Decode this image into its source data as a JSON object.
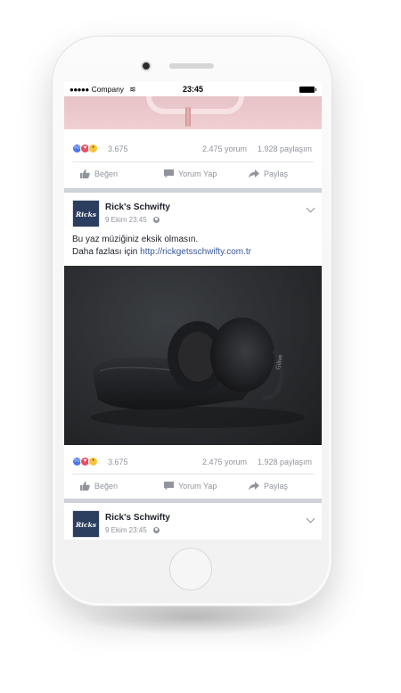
{
  "status_bar": {
    "signal": "●●●●●",
    "carrier": "Company",
    "wifi": "≋",
    "time": "23:45"
  },
  "post_top": {
    "reaction_count": "3.675",
    "comments": "2.475 yorum",
    "shares": "1.928 paylaşım",
    "actions": {
      "like": "Beğen",
      "comment": "Yorum Yap",
      "share": "Paylaş"
    }
  },
  "post_main": {
    "page_name": "Rick's Schwifty",
    "avatar_text": "Ricks",
    "date": "9 Ekim 23:45",
    "text_line1": "Bu yaz müziğiniz eksik olmasın.",
    "text_line2_prefix": "Daha fazlası için",
    "link": "http://rickgetsschwifty.com.tr",
    "reaction_count": "3.675",
    "comments": "2.475 yorum",
    "shares": "1.928 paylaşım",
    "actions": {
      "like": "Beğen",
      "comment": "Yorum Yap",
      "share": "Paylaş"
    },
    "headphone_brand": "Gilive"
  },
  "post_next": {
    "page_name": "Rick's Schwifty",
    "avatar_text": "Ricks",
    "date": "9 Ekim 23:45"
  },
  "colors": {
    "like": "#4a76ea",
    "love": "#ef4b5f",
    "wow": "#f7c33a",
    "link": "#365899",
    "secondary_text": "#90949c"
  },
  "icons": [
    "like-thumb-icon",
    "comment-icon",
    "share-arrow-icon",
    "globe-icon",
    "chevron-down-icon",
    "wifi-icon",
    "battery-icon"
  ]
}
